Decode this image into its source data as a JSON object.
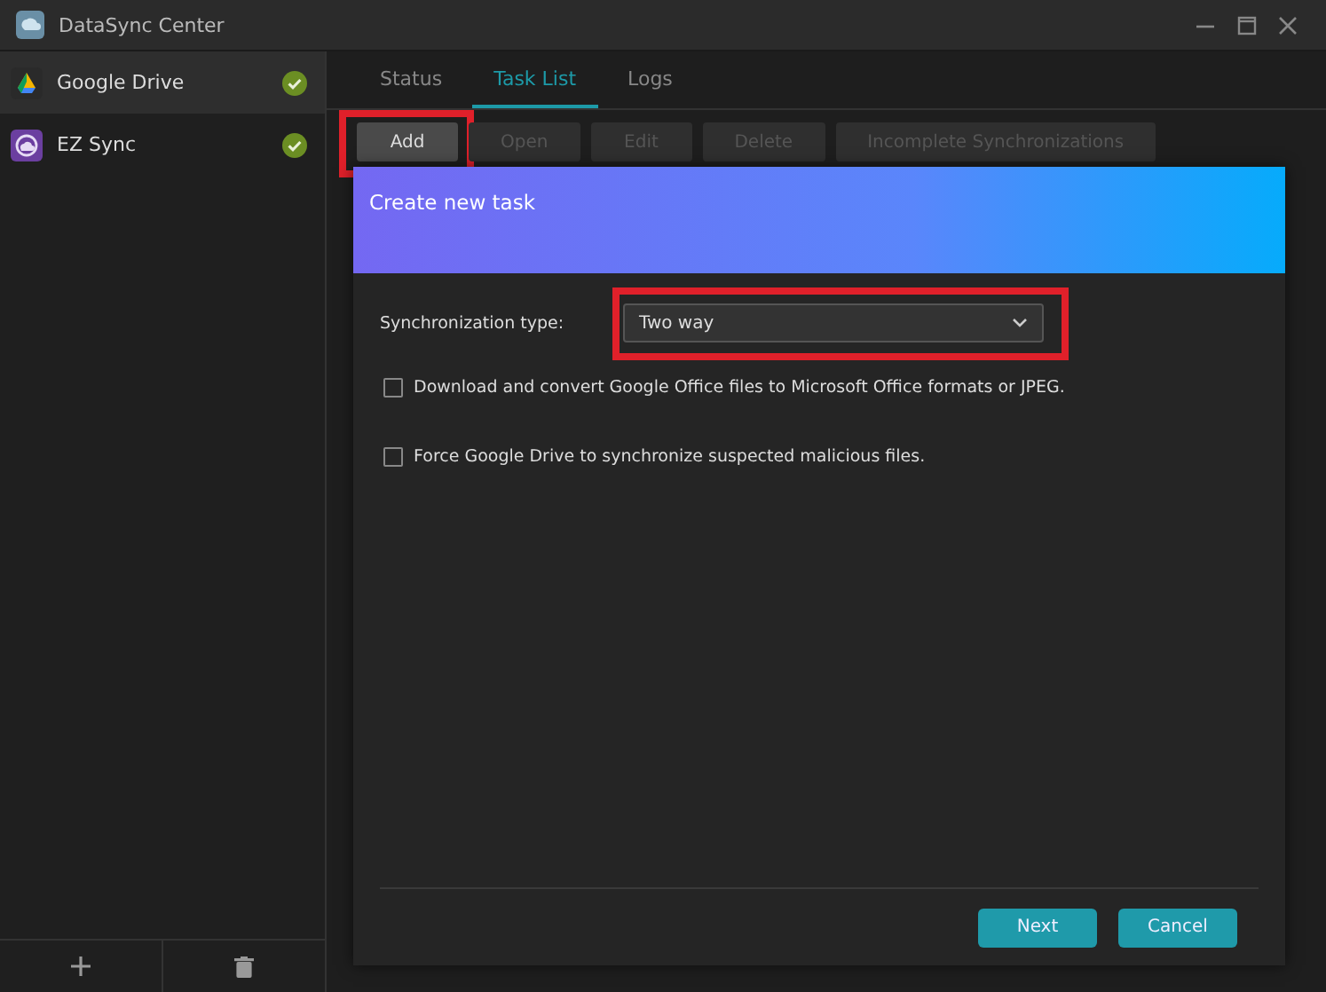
{
  "window": {
    "title": "DataSync Center"
  },
  "sidebar": {
    "items": [
      {
        "label": "Google Drive",
        "selected": true,
        "status_ok": true,
        "kind": "drive"
      },
      {
        "label": "EZ Sync",
        "selected": false,
        "status_ok": true,
        "kind": "ezsync"
      }
    ]
  },
  "tabs": [
    {
      "label": "Status",
      "selected": false
    },
    {
      "label": "Task List",
      "selected": true
    },
    {
      "label": "Logs",
      "selected": false
    }
  ],
  "toolbar": [
    {
      "label": "Add",
      "disabled": false,
      "highlighted": true
    },
    {
      "label": "Open",
      "disabled": true,
      "highlighted": false
    },
    {
      "label": "Edit",
      "disabled": true,
      "highlighted": false
    },
    {
      "label": "Delete",
      "disabled": true,
      "highlighted": false
    },
    {
      "label": "Incomplete Synchronizations",
      "disabled": true,
      "highlighted": false
    }
  ],
  "dialog": {
    "title": "Create new task",
    "sync_type": {
      "label": "Synchronization type:",
      "value": "Two way",
      "highlighted": true
    },
    "options": [
      {
        "label": "Download and convert Google Office files to Microsoft Office formats or JPEG.",
        "checked": false
      },
      {
        "label": "Force Google Drive to synchronize suspected malicious files.",
        "checked": false
      }
    ],
    "buttons": [
      "Next",
      "Cancel"
    ]
  }
}
